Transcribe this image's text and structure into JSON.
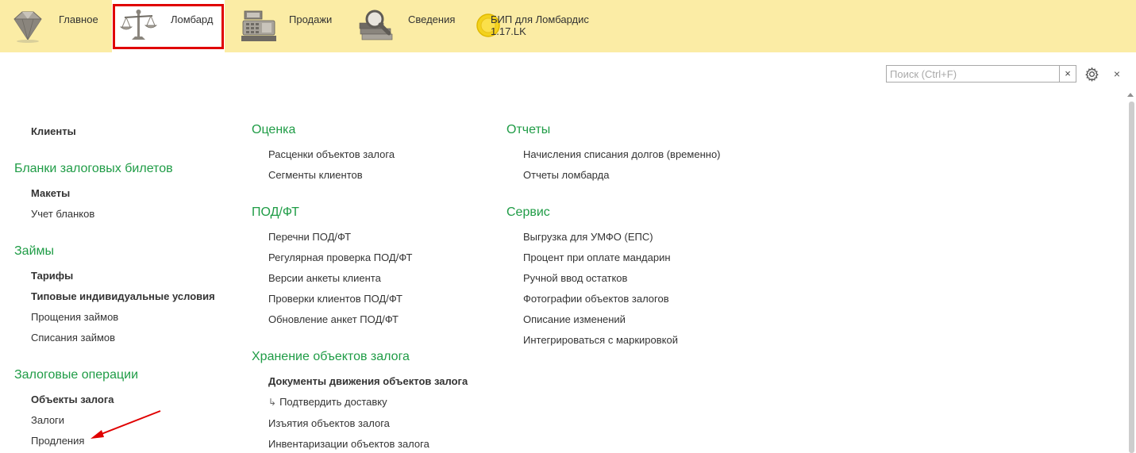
{
  "sections": [
    {
      "key": "glavnoe",
      "label": "Главное",
      "icon": "diamond-icon",
      "active": false
    },
    {
      "key": "lombard",
      "label": "Ломбард",
      "icon": "scales-icon",
      "active": true
    },
    {
      "key": "prodazhi",
      "label": "Продажи",
      "icon": "cash-register-icon",
      "active": false
    },
    {
      "key": "svedeniya",
      "label": "Сведения",
      "icon": "books-magnifier-icon",
      "active": false
    },
    {
      "key": "bip",
      "label": "БИП для Ломбардис",
      "label2": "1.17.LK",
      "icon": "coin-icon",
      "active": false
    }
  ],
  "toolbar": {
    "search_placeholder": "Поиск (Ctrl+F)",
    "clear": "×",
    "close": "×"
  },
  "colors": {
    "panel": "#fbeca5",
    "group_title": "#1f9c46",
    "active_frame": "#e00000",
    "annotation_arrow": "#e00000"
  },
  "menu": {
    "col1": {
      "top_item": "Клиенты",
      "blanki": {
        "title": "Бланки залоговых билетов",
        "items": [
          "Макеты",
          "Учет бланков"
        ]
      },
      "zaimy": {
        "title": "Займы",
        "items": [
          "Тарифы",
          "Типовые индивидуальные условия",
          "Прощения займов",
          "Списания займов"
        ]
      },
      "zalog_ops": {
        "title": "Залоговые операции",
        "items": [
          "Объекты залога",
          "Залоги",
          "Продления"
        ]
      }
    },
    "col2": {
      "ocenka": {
        "title": "Оценка",
        "items": [
          "Расценки объектов залога",
          "Сегменты клиентов"
        ]
      },
      "podft": {
        "title": "ПОД/ФТ",
        "items": [
          "Перечни ПОД/ФТ",
          "Регулярная проверка ПОД/ФТ",
          "Версии анкеты клиента",
          "Проверки клиентов ПОД/ФТ",
          "Обновление анкет ПОД/ФТ"
        ]
      },
      "hranenie": {
        "title": "Хранение объектов залога",
        "items": [
          "Документы движения объектов залога",
          "Подтвердить доставку",
          "Изъятия объектов залога",
          "Инвентаризации объектов залога"
        ]
      }
    },
    "col3": {
      "otchety": {
        "title": "Отчеты",
        "items": [
          "Начисления списания долгов (временно)",
          "Отчеты ломбарда"
        ]
      },
      "servis": {
        "title": "Сервис",
        "items": [
          "Выгрузка для УМФО (ЕПС)",
          "Процент при оплате мандарин",
          "Ручной ввод остатков",
          "Фотографии объектов залогов",
          "Описание изменений",
          "Интегрироваться с маркировкой"
        ]
      }
    }
  }
}
